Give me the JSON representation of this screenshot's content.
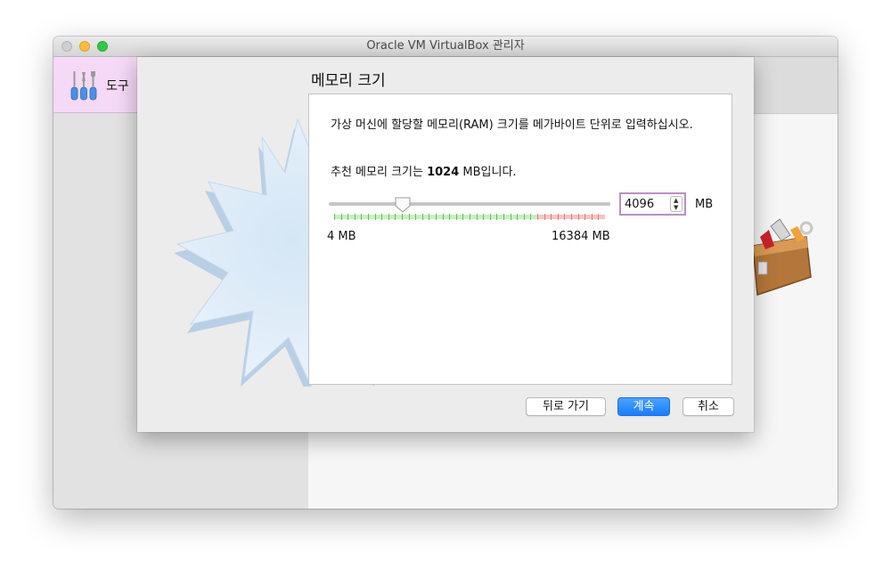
{
  "window": {
    "title": "Oracle VM VirtualBox 관리자"
  },
  "sidebar": {
    "tools_label": "도구"
  },
  "dialog": {
    "title": "메모리 크기",
    "description": "가상 머신에 할당할 메모리(RAM) 크기를 메가바이트 단위로 입력하십시오.",
    "recommended_prefix": "추천 메모리 크기는 ",
    "recommended_value": "1024",
    "recommended_suffix": " MB입니다.",
    "slider": {
      "value": 4096,
      "min_label": "4 MB",
      "max_label": "16384 MB",
      "min": 4,
      "max": 16384
    },
    "memory_input": {
      "value": "4096",
      "unit": "MB"
    },
    "buttons": {
      "back": "뒤로 가기",
      "next": "계속",
      "cancel": "취소"
    }
  },
  "icons": [
    "tools-icon",
    "toolbox-icon",
    "starburst-icon",
    "slider-thumb-icon",
    "stepper-icon"
  ],
  "colors": {
    "accent": "#1a7cfa",
    "tools_highlight": "#f5d9f7",
    "input_focus": "#b98fc4"
  }
}
